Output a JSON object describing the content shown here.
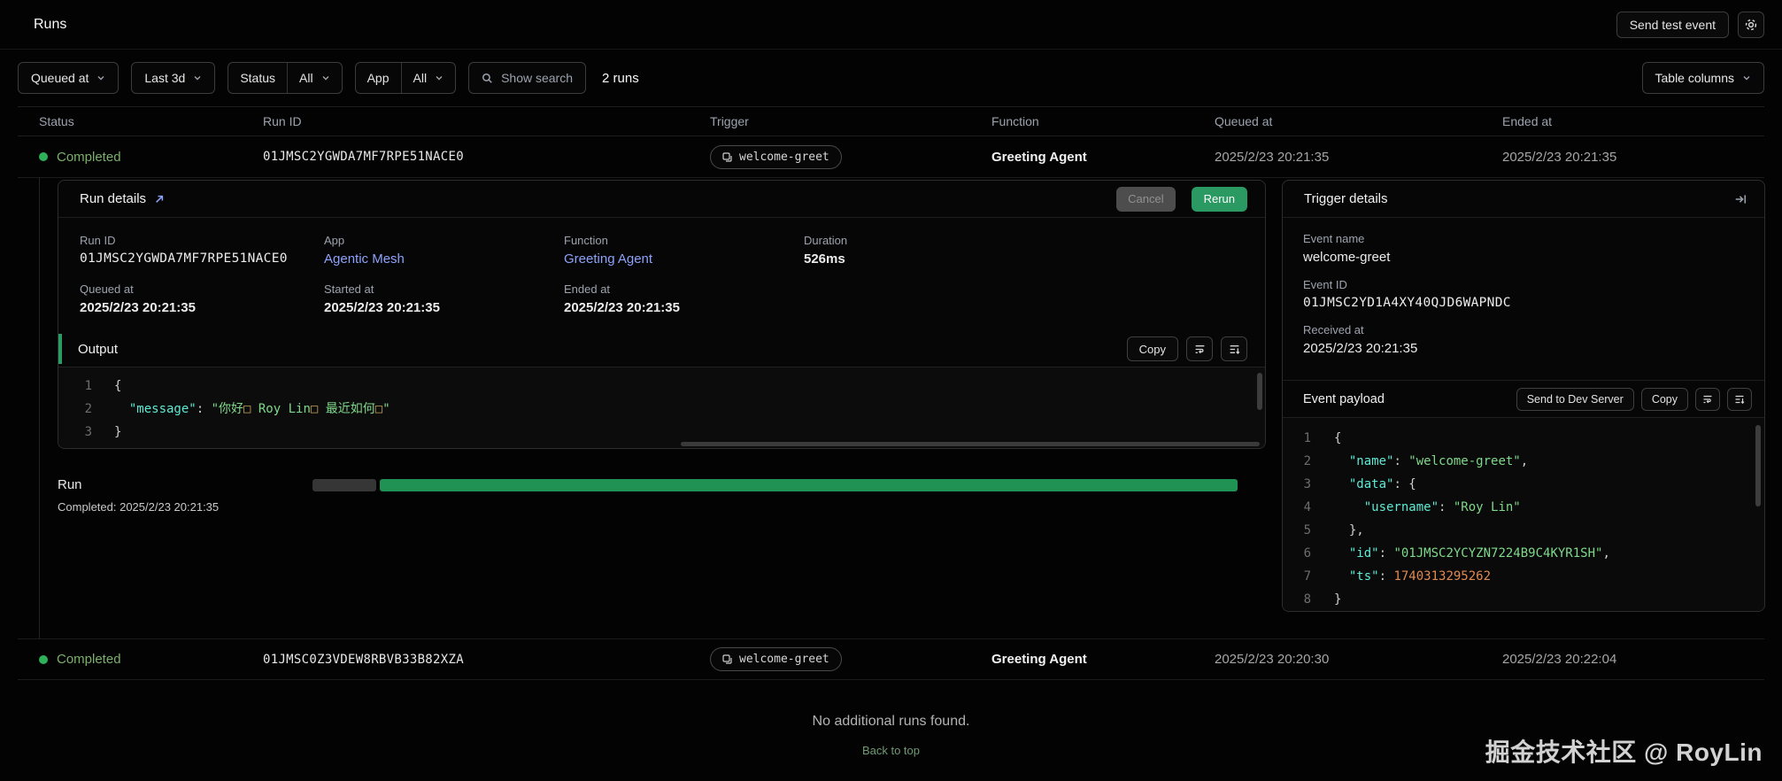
{
  "topbar": {
    "title": "Runs",
    "send_test_event": "Send test event"
  },
  "filters": {
    "queued_at": "Queued at",
    "range": "Last 3d",
    "status_label": "Status",
    "status_value": "All",
    "app_label": "App",
    "app_value": "All",
    "search": "Show search",
    "count": "2 runs",
    "table_columns": "Table columns"
  },
  "table": {
    "columns": {
      "status": "Status",
      "run_id": "Run ID",
      "trigger": "Trigger",
      "function": "Function",
      "queued_at": "Queued at",
      "ended_at": "Ended at"
    },
    "rows": [
      {
        "status": "Completed",
        "run_id": "01JMSC2YGWDA7MF7RPE51NACE0",
        "trigger": "welcome-greet",
        "function": "Greeting Agent",
        "queued_at": "2025/2/23 20:21:35",
        "ended_at": "2025/2/23 20:21:35"
      },
      {
        "status": "Completed",
        "run_id": "01JMSC0Z3VDEW8RBVB33B82XZA",
        "trigger": "welcome-greet",
        "function": "Greeting Agent",
        "queued_at": "2025/2/23 20:20:30",
        "ended_at": "2025/2/23 20:22:04"
      }
    ]
  },
  "run_details": {
    "title": "Run details",
    "cancel": "Cancel",
    "rerun": "Rerun",
    "fields": {
      "run_id": {
        "label": "Run ID",
        "value": "01JMSC2YGWDA7MF7RPE51NACE0"
      },
      "app": {
        "label": "App",
        "value": "Agentic Mesh"
      },
      "function": {
        "label": "Function",
        "value": "Greeting Agent"
      },
      "duration": {
        "label": "Duration",
        "value": "526ms"
      },
      "queued_at": {
        "label": "Queued at",
        "value": "2025/2/23 20:21:35"
      },
      "started_at": {
        "label": "Started at",
        "value": "2025/2/23 20:21:35"
      },
      "ended_at": {
        "label": "Ended at",
        "value": "2025/2/23 20:21:35"
      }
    },
    "output": {
      "label": "Output",
      "copy": "Copy",
      "code": [
        {
          "n": "1",
          "t": [
            {
              "c": "p",
              "v": "{"
            }
          ]
        },
        {
          "n": "2",
          "t": [
            {
              "c": "p",
              "v": "  "
            },
            {
              "c": "k",
              "v": "\"message\""
            },
            {
              "c": "p",
              "v": ": "
            },
            {
              "c": "s",
              "v": "\"你好"
            },
            {
              "c": "b",
              "v": "□"
            },
            {
              "c": "s",
              "v": " Roy Lin"
            },
            {
              "c": "b",
              "v": "□"
            },
            {
              "c": "s",
              "v": " 最近如何"
            },
            {
              "c": "b",
              "v": "□"
            },
            {
              "c": "s",
              "v": "\""
            }
          ]
        },
        {
          "n": "3",
          "t": [
            {
              "c": "p",
              "v": "}"
            }
          ]
        }
      ]
    }
  },
  "timeline": {
    "label": "Run",
    "completed": "Completed: 2025/2/23 20:21:35"
  },
  "trigger_details": {
    "title": "Trigger details",
    "event_name": {
      "label": "Event name",
      "value": "welcome-greet"
    },
    "event_id": {
      "label": "Event ID",
      "value": "01JMSC2YD1A4XY40QJD6WAPNDC"
    },
    "received_at": {
      "label": "Received at",
      "value": "2025/2/23 20:21:35"
    },
    "payload": {
      "label": "Event payload",
      "send_to_dev_server": "Send to Dev Server",
      "copy": "Copy",
      "code": [
        {
          "n": "1",
          "t": [
            {
              "c": "p",
              "v": "{"
            }
          ]
        },
        {
          "n": "2",
          "t": [
            {
              "c": "p",
              "v": "  "
            },
            {
              "c": "k",
              "v": "\"name\""
            },
            {
              "c": "p",
              "v": ": "
            },
            {
              "c": "s",
              "v": "\"welcome-greet\""
            },
            {
              "c": "p",
              "v": ","
            }
          ]
        },
        {
          "n": "3",
          "t": [
            {
              "c": "p",
              "v": "  "
            },
            {
              "c": "k",
              "v": "\"data\""
            },
            {
              "c": "p",
              "v": ": {"
            }
          ]
        },
        {
          "n": "4",
          "t": [
            {
              "c": "p",
              "v": "    "
            },
            {
              "c": "k",
              "v": "\"username\""
            },
            {
              "c": "p",
              "v": ": "
            },
            {
              "c": "s",
              "v": "\"Roy Lin\""
            }
          ]
        },
        {
          "n": "5",
          "t": [
            {
              "c": "p",
              "v": "  },"
            }
          ]
        },
        {
          "n": "6",
          "t": [
            {
              "c": "p",
              "v": "  "
            },
            {
              "c": "k",
              "v": "\"id\""
            },
            {
              "c": "p",
              "v": ": "
            },
            {
              "c": "s",
              "v": "\"01JMSC2YCYZN7224B9C4KYR1SH\""
            },
            {
              "c": "p",
              "v": ","
            }
          ]
        },
        {
          "n": "7",
          "t": [
            {
              "c": "p",
              "v": "  "
            },
            {
              "c": "k",
              "v": "\"ts\""
            },
            {
              "c": "p",
              "v": ": "
            },
            {
              "c": "n",
              "v": "1740313295262"
            }
          ]
        },
        {
          "n": "8",
          "t": [
            {
              "c": "p",
              "v": "}"
            }
          ]
        }
      ]
    }
  },
  "footer": {
    "no_more": "No additional runs found.",
    "back_to_top": "Back to top"
  },
  "watermark": "掘金技术社区 @ RoyLin",
  "colors": {
    "accent_green": "#2c9b63",
    "status_green": "#2eb158",
    "link_blue": "#8da2fb",
    "code_key": "#5eead4",
    "code_string": "#7fd98a",
    "code_number": "#e08a52"
  }
}
